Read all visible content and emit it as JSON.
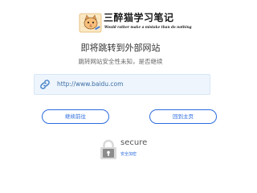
{
  "logo": {
    "title": "三醉猫学习笔记",
    "subtitle": "Would rather make a mistake than do nothing"
  },
  "heading": "即将跳转到外部网站",
  "subheading": "跳转网站安全性未知，是否继续",
  "url": {
    "text": "http://www.baidu.com",
    "icon": "link-icon"
  },
  "buttons": {
    "continue_label": "继续前往",
    "home_label": "回到主页"
  },
  "badge": {
    "label": "secure",
    "sub_label": "安全加密",
    "icon": "lock-icon"
  },
  "colors": {
    "accent": "#2d6cdf",
    "url_box_bg": "#eef5fd",
    "url_text": "#3b6ea5",
    "heading": "#333333",
    "subheading": "#666666"
  }
}
